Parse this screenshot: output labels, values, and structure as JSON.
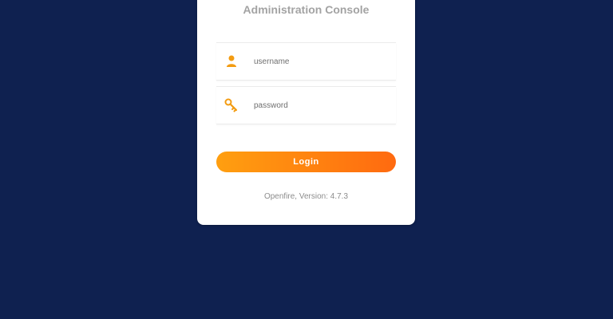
{
  "window": {
    "title": "Administration Console"
  },
  "login_form": {
    "username": {
      "icon": "user-icon",
      "placeholder": "username",
      "value": ""
    },
    "password": {
      "icon": "key-icon",
      "placeholder": "password",
      "value": ""
    },
    "login_label": "Login"
  },
  "footer": {
    "version_text": "Openfire, Version: 4.7.3"
  },
  "colors": {
    "background": "#0f2150",
    "card": "#ffffff",
    "accent_start": "#ff9f10",
    "accent_end": "#ff6a10",
    "icon": "#f39c12"
  }
}
